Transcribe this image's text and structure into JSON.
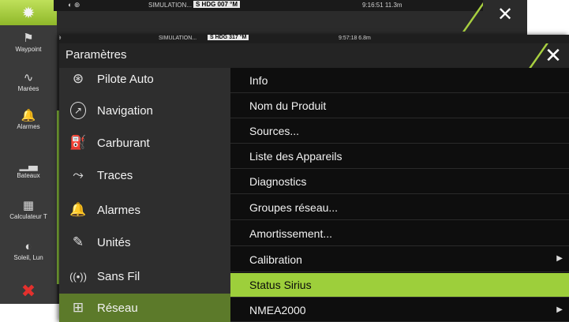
{
  "back": {
    "status": {
      "icons": "◐ ⊕",
      "simulation": "SIMULATION...",
      "hdg": "S HDG 007 °M",
      "time": "9:16:51  11.3m"
    },
    "sidebar": [
      {
        "icon": "settings-gear",
        "label": ""
      },
      {
        "icon": "waypoint-flag",
        "label": "Waypoint"
      },
      {
        "icon": "tides-wave",
        "label": "Marées"
      },
      {
        "icon": "alarm-bell",
        "label": "Alarmes"
      },
      {
        "icon": "vessel",
        "label": "Bateaux"
      },
      {
        "icon": "calculator",
        "label": "Calculateur T"
      },
      {
        "icon": "sun-moon",
        "label": "Soleil, Lun"
      }
    ],
    "close_glyph": "✕",
    "red_close_glyph": "✖"
  },
  "front": {
    "status": {
      "icon": "⊕",
      "simulation": "SIMULATION...",
      "hdg": "S HDG 317 °M",
      "time": "9:57:18  6.8m"
    },
    "title": "Paramètres",
    "close_glyph": "✕",
    "left_menu": [
      {
        "icon": "autopilot-icon",
        "glyph": "⊛",
        "label": "Pilote Auto"
      },
      {
        "icon": "navigation-icon",
        "glyph": "⟋",
        "label": "Navigation"
      },
      {
        "icon": "fuel-icon",
        "glyph": "⛽",
        "label": "Carburant"
      },
      {
        "icon": "tracks-icon",
        "glyph": "⤳",
        "label": "Traces"
      },
      {
        "icon": "alarm-icon",
        "glyph": "🔔",
        "label": "Alarmes"
      },
      {
        "icon": "units-icon",
        "glyph": "✎",
        "label": "Unités"
      },
      {
        "icon": "wireless-icon",
        "glyph": "((•))",
        "label": "Sans Fil"
      },
      {
        "icon": "network-icon",
        "glyph": "⊞",
        "label": "Réseau"
      }
    ],
    "right_list": [
      {
        "label": "Info",
        "arrow": ""
      },
      {
        "label": "Nom du Produit",
        "arrow": ""
      },
      {
        "label": "Sources...",
        "arrow": ""
      },
      {
        "label": "Liste des Appareils",
        "arrow": ""
      },
      {
        "label": "Diagnostics",
        "arrow": ""
      },
      {
        "label": "Groupes réseau...",
        "arrow": ""
      },
      {
        "label": "Amortissement...",
        "arrow": ""
      },
      {
        "label": "Calibration",
        "arrow": "▶"
      },
      {
        "label": "Status Sirius",
        "arrow": ""
      },
      {
        "label": "NMEA2000",
        "arrow": "▶"
      }
    ]
  },
  "colors": {
    "accent": "#9dcf3b",
    "active_left": "#5c7a2a",
    "alert": "#e4302d"
  }
}
